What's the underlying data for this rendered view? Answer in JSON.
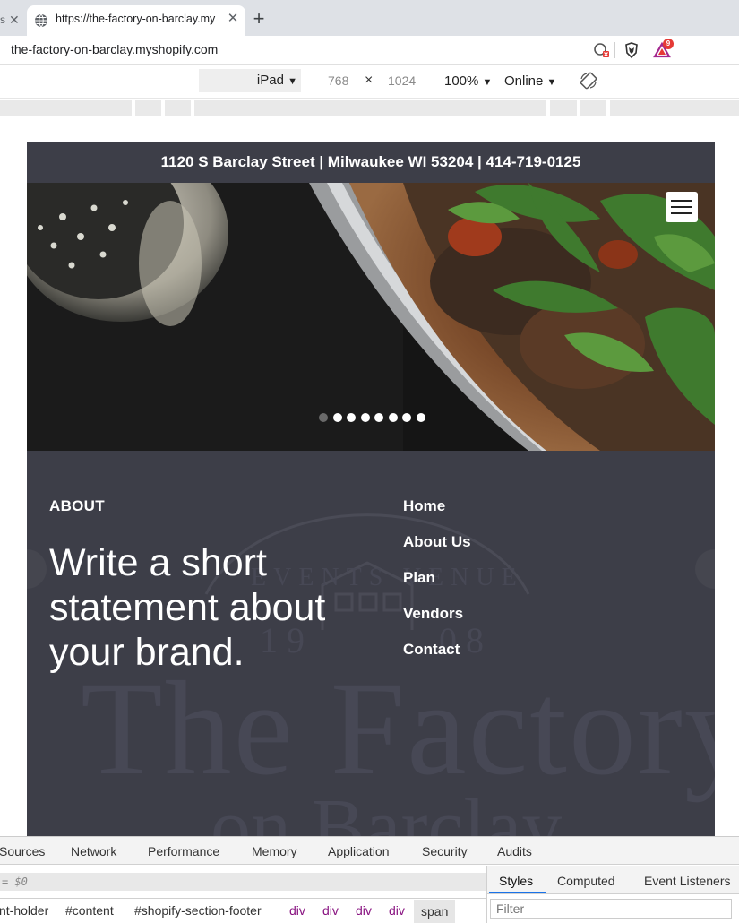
{
  "browser": {
    "prev_tab_label": "s",
    "active_tab_title": "https://the-factory-on-barclay.my",
    "new_tab_symbol": "+",
    "close_symbol": "✕",
    "url": "the-factory-on-barclay.myshopify.com",
    "extension_badge_count": "9"
  },
  "device_toolbar": {
    "device": "iPad",
    "width": "768",
    "times": "×",
    "height": "1024",
    "zoom": "100%",
    "network": "Online",
    "caret": "▼"
  },
  "site": {
    "announcement": "1120 S Barclay Street | Milwaukee WI 53204 | 414-719-0125",
    "slideshow": {
      "slide_count": 8,
      "active_index": 0
    },
    "footer": {
      "about_heading": "ABOUT",
      "about_text": "Write a short statement about your brand.",
      "nav": [
        "Home",
        "About Us",
        "Plan",
        "Vendors",
        "Contact"
      ]
    }
  },
  "devtools": {
    "tabs": [
      "Sources",
      "Network",
      "Performance",
      "Memory",
      "Application",
      "Security",
      "Audits"
    ],
    "console_text": "= $0",
    "sidebar_tabs": [
      "Styles",
      "Computed",
      "Event Listeners"
    ],
    "active_sidebar_tab": "Styles",
    "breadcrumbs": [
      "nt-holder",
      "#content",
      "#shopify-section-footer",
      "div",
      "div",
      "div",
      "div",
      "span"
    ],
    "filter_placeholder": "Filter"
  }
}
